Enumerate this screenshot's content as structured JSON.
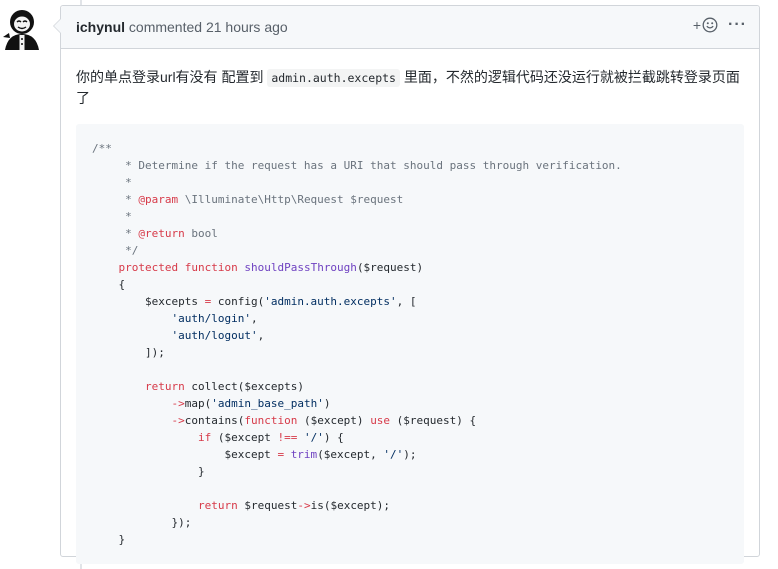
{
  "comment": {
    "author": "ichynul",
    "action": "commented",
    "time": "21 hours ago",
    "body": {
      "before": "你的单点登录url有没有 配置到 ",
      "code": "admin.auth.excepts",
      "after": " 里面，不然的逻辑代码还没运行就被拦截跳转登录页面了"
    }
  },
  "header_actions": {
    "plus": "+",
    "kebab": "···"
  },
  "icons": [
    "avatar",
    "smiley-icon",
    "kebab-icon"
  ],
  "code_lines": [
    [
      [
        "/**",
        "c"
      ]
    ],
    [
      [
        "     * Determine if the request has a URI that should pass through verification.",
        "c"
      ]
    ],
    [
      [
        "     *",
        "c"
      ]
    ],
    [
      [
        "     * ",
        "c"
      ],
      [
        "@param",
        "k"
      ],
      [
        " \\Illuminate\\Http\\Request $request",
        "c"
      ]
    ],
    [
      [
        "     *",
        "c"
      ]
    ],
    [
      [
        "     * ",
        "c"
      ],
      [
        "@return",
        "k"
      ],
      [
        " bool",
        "c"
      ]
    ],
    [
      [
        "     */",
        "c"
      ]
    ],
    [
      [
        "    ",
        ""
      ],
      [
        "protected",
        "k"
      ],
      [
        " ",
        ""
      ],
      [
        "function",
        "k"
      ],
      [
        " ",
        ""
      ],
      [
        "shouldPassThrough",
        "f"
      ],
      [
        "($request)",
        ""
      ]
    ],
    [
      [
        "    {",
        ""
      ]
    ],
    [
      [
        "        $excepts ",
        ""
      ],
      [
        "=",
        "k"
      ],
      [
        " config(",
        ""
      ],
      [
        "'admin.auth.excepts'",
        "s"
      ],
      [
        ", [",
        ""
      ]
    ],
    [
      [
        "            ",
        ""
      ],
      [
        "'auth/login'",
        "s"
      ],
      [
        ",",
        ""
      ]
    ],
    [
      [
        "            ",
        ""
      ],
      [
        "'auth/logout'",
        "s"
      ],
      [
        ",",
        ""
      ]
    ],
    [
      [
        "        ]);",
        ""
      ]
    ],
    [
      [
        "",
        ""
      ]
    ],
    [
      [
        "        ",
        ""
      ],
      [
        "return",
        "k"
      ],
      [
        " collect($excepts)",
        ""
      ]
    ],
    [
      [
        "            ",
        ""
      ],
      [
        "->",
        "k"
      ],
      [
        "map(",
        ""
      ],
      [
        "'admin_base_path'",
        "s"
      ],
      [
        ")",
        ""
      ]
    ],
    [
      [
        "            ",
        ""
      ],
      [
        "->",
        "k"
      ],
      [
        "contains(",
        ""
      ],
      [
        "function",
        "k"
      ],
      [
        " ($except) ",
        ""
      ],
      [
        "use",
        "k"
      ],
      [
        " ($request) {",
        ""
      ]
    ],
    [
      [
        "                ",
        ""
      ],
      [
        "if",
        "k"
      ],
      [
        " ($except ",
        ""
      ],
      [
        "!==",
        "k"
      ],
      [
        " ",
        ""
      ],
      [
        "'/'",
        "s"
      ],
      [
        ") {",
        ""
      ]
    ],
    [
      [
        "                    $except ",
        ""
      ],
      [
        "=",
        "k"
      ],
      [
        " ",
        ""
      ],
      [
        "trim",
        "f"
      ],
      [
        "($except, ",
        ""
      ],
      [
        "'/'",
        "s"
      ],
      [
        ");",
        ""
      ]
    ],
    [
      [
        "                }",
        ""
      ]
    ],
    [
      [
        "",
        ""
      ]
    ],
    [
      [
        "                ",
        ""
      ],
      [
        "return",
        "k"
      ],
      [
        " $request",
        ""
      ],
      [
        "->",
        "k"
      ],
      [
        "is($except);",
        ""
      ]
    ],
    [
      [
        "            });",
        ""
      ]
    ],
    [
      [
        "    }",
        ""
      ]
    ]
  ]
}
